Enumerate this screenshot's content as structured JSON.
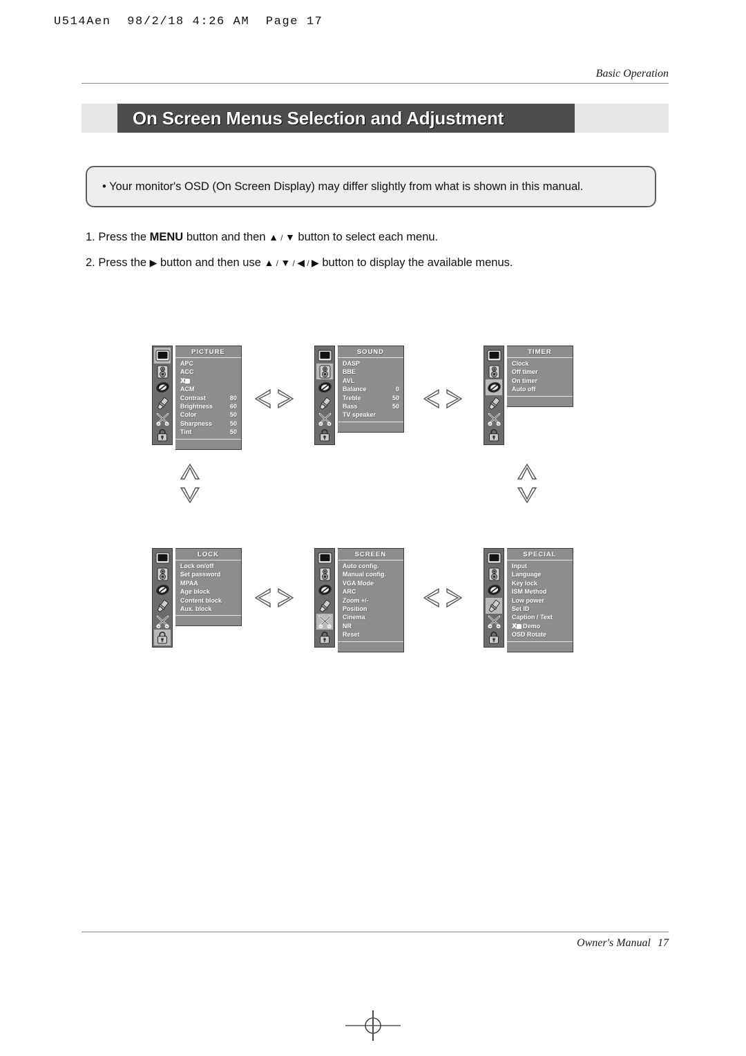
{
  "print_header": "U514Aen  98/2/18 4:26 AM  Page 17",
  "running_head": "Basic Operation",
  "title": "On Screen Menus Selection and Adjustment",
  "note": "• Your monitor's OSD (On Screen Display) may differ slightly from what is shown in this manual.",
  "steps": {
    "step1_a": "1. Press the ",
    "step1_menu": "MENU",
    "step1_b": " button and then ",
    "step1_c": " button to select each menu.",
    "step2_a": "2. Press the ",
    "step2_b": " button and then use ",
    "step2_c": " button to display the available menus."
  },
  "icons": {
    "picture": "monitor-icon",
    "sound": "speaker-icon",
    "timer": "clock-icon",
    "special": "brush-icon",
    "screen": "scissors-icon",
    "lock": "padlock-icon"
  },
  "arrows": {
    "left": "chevron-left-outline",
    "right": "chevron-right-outline",
    "up": "chevron-up-outline",
    "down": "chevron-down-outline"
  },
  "menus": [
    {
      "id": "picture",
      "title": "PICTURE",
      "selected_icon": 0,
      "items": [
        {
          "label": "APC",
          "value": ""
        },
        {
          "label": "ACC",
          "value": ""
        },
        {
          "label": "XD",
          "value": "",
          "logo": true
        },
        {
          "label": "ACM",
          "value": ""
        },
        {
          "label": "Contrast",
          "value": "80"
        },
        {
          "label": "Brightness",
          "value": "60"
        },
        {
          "label": "Color",
          "value": "50"
        },
        {
          "label": "Sharpness",
          "value": "50"
        },
        {
          "label": "Tint",
          "value": "50"
        }
      ]
    },
    {
      "id": "sound",
      "title": "SOUND",
      "selected_icon": 1,
      "items": [
        {
          "label": "DASP",
          "value": ""
        },
        {
          "label": "BBE",
          "value": ""
        },
        {
          "label": "AVL",
          "value": ""
        },
        {
          "label": "Balance",
          "value": "0"
        },
        {
          "label": "Treble",
          "value": "50"
        },
        {
          "label": "Bass",
          "value": "50"
        },
        {
          "label": "TV speaker",
          "value": ""
        }
      ]
    },
    {
      "id": "timer",
      "title": "TIMER",
      "selected_icon": 2,
      "items": [
        {
          "label": "Clock",
          "value": ""
        },
        {
          "label": "Off timer",
          "value": ""
        },
        {
          "label": "On timer",
          "value": ""
        },
        {
          "label": "Auto off",
          "value": ""
        }
      ]
    },
    {
      "id": "lock",
      "title": "LOCK",
      "selected_icon": 5,
      "items": [
        {
          "label": "Lock on/off",
          "value": ""
        },
        {
          "label": "Set password",
          "value": ""
        },
        {
          "label": "MPAA",
          "value": ""
        },
        {
          "label": "Age block",
          "value": ""
        },
        {
          "label": "Content block",
          "value": ""
        },
        {
          "label": "Aux. block",
          "value": ""
        }
      ]
    },
    {
      "id": "screen",
      "title": "SCREEN",
      "selected_icon": 4,
      "items": [
        {
          "label": "Auto config.",
          "value": ""
        },
        {
          "label": "Manual config.",
          "value": ""
        },
        {
          "label": "VGA Mode",
          "value": ""
        },
        {
          "label": "ARC",
          "value": ""
        },
        {
          "label": "Zoom +/-",
          "value": ""
        },
        {
          "label": "Position",
          "value": ""
        },
        {
          "label": "Cinema",
          "value": ""
        },
        {
          "label": "NR",
          "value": ""
        },
        {
          "label": "Reset",
          "value": ""
        }
      ]
    },
    {
      "id": "special",
      "title": "SPECIAL",
      "selected_icon": 3,
      "items": [
        {
          "label": "Input",
          "value": ""
        },
        {
          "label": "Language",
          "value": ""
        },
        {
          "label": "Key lock",
          "value": ""
        },
        {
          "label": "ISM Method",
          "value": ""
        },
        {
          "label": "Low power",
          "value": ""
        },
        {
          "label": "Set ID",
          "value": ""
        },
        {
          "label": "Caption / Text",
          "value": ""
        },
        {
          "label": "XD Demo",
          "value": "",
          "logo_prefix": true
        },
        {
          "label": "OSD Rotate",
          "value": ""
        }
      ]
    }
  ],
  "footer": {
    "label": "Owner's Manual",
    "page": "17"
  }
}
